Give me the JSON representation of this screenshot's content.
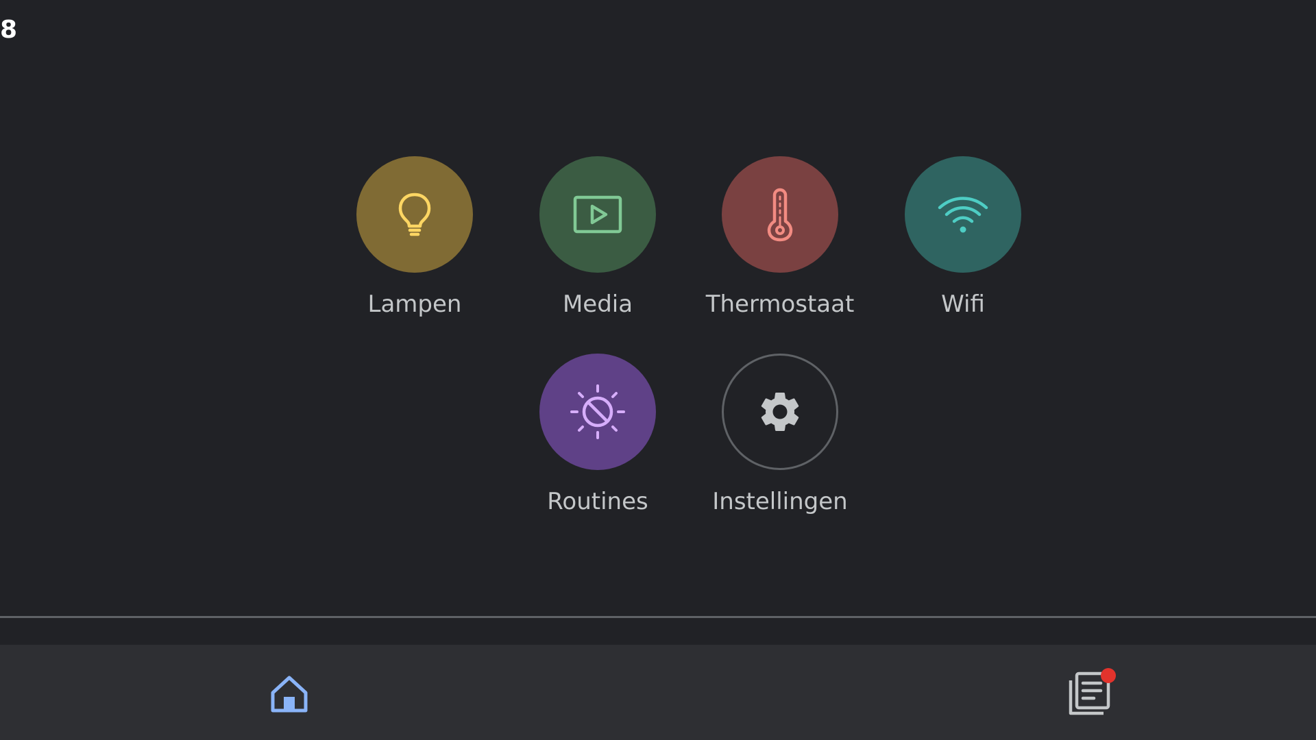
{
  "status": {
    "text": "8"
  },
  "tiles": [
    {
      "label": "Lampen",
      "icon": "lightbulb-icon",
      "bg": "#806b34",
      "fg": "#fdd663"
    },
    {
      "label": "Media",
      "icon": "play-screen-icon",
      "bg": "#3b5c43",
      "fg": "#81c995"
    },
    {
      "label": "Thermostaat",
      "icon": "thermometer-icon",
      "bg": "#7a4141",
      "fg": "#f28b82"
    },
    {
      "label": "Wifi",
      "icon": "wifi-icon",
      "bg": "#2f6461",
      "fg": "#4ecdc4"
    },
    {
      "label": "Routines",
      "icon": "routines-sun-moon-icon",
      "bg": "#5f4187",
      "fg": "#d7aefb"
    },
    {
      "label": "Instellingen",
      "icon": "gear-icon",
      "bg": "transparent",
      "fg": "#c4c7c9"
    }
  ],
  "nav": {
    "home": {
      "icon": "home-icon",
      "color": "#8ab4f8"
    },
    "feed": {
      "icon": "feed-icon",
      "color": "#c4c7c9",
      "badge_color": "#e2332c"
    }
  }
}
